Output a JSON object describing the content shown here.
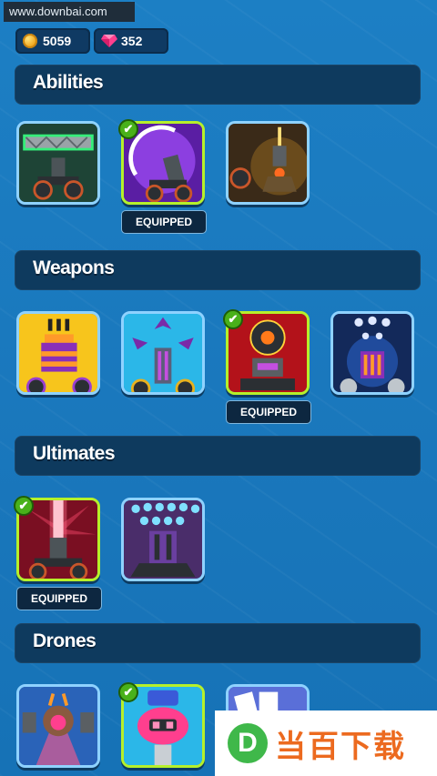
{
  "watermark_top": "www.downbai.com",
  "currency": {
    "coins": "5059",
    "gems": "352"
  },
  "sections": {
    "abilities": {
      "title": "Abilities"
    },
    "weapons": {
      "title": "Weapons"
    },
    "ultimates": {
      "title": "Ultimates"
    },
    "drones": {
      "title": "Drones"
    }
  },
  "equipped_label": "EQUIPPED",
  "colors": {
    "equipped_border": "#b6f02a",
    "card_border": "#8fd2ff",
    "section_bg": "#0e3a5e"
  },
  "watermark_bottom": {
    "logo_letter": "D",
    "text": "当百下载"
  }
}
